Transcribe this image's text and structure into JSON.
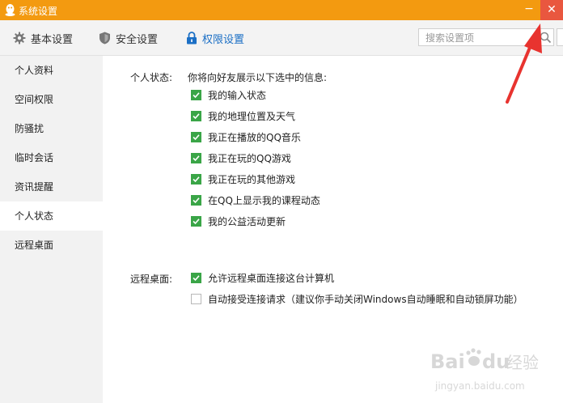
{
  "window": {
    "title": "系统设置",
    "minimize_glyph": "−",
    "close_glyph": "✕",
    "accent": "#f39a10",
    "close_bg": "#e9573f"
  },
  "toolbar": {
    "tabs": [
      {
        "label": "基本设置",
        "icon": "gear-icon",
        "active": false
      },
      {
        "label": "安全设置",
        "icon": "shield-icon",
        "active": false
      },
      {
        "label": "权限设置",
        "icon": "lock-icon",
        "active": true
      }
    ],
    "search_placeholder": "搜索设置项",
    "active_color": "#1b6fc5"
  },
  "sidebar": {
    "items": [
      {
        "label": "个人资料",
        "active": false
      },
      {
        "label": "空间权限",
        "active": false
      },
      {
        "label": "防骚扰",
        "active": false
      },
      {
        "label": "临时会话",
        "active": false
      },
      {
        "label": "资讯提醒",
        "active": false
      },
      {
        "label": "个人状态",
        "active": true
      },
      {
        "label": "远程桌面",
        "active": false
      }
    ]
  },
  "personal_status": {
    "label": "个人状态:",
    "intro": "你将向好友展示以下选中的信息:",
    "options": [
      {
        "label": "我的输入状态",
        "checked": true
      },
      {
        "label": "我的地理位置及天气",
        "checked": true
      },
      {
        "label": "我正在播放的QQ音乐",
        "checked": true
      },
      {
        "label": "我正在玩的QQ游戏",
        "checked": true
      },
      {
        "label": "我正在玩的其他游戏",
        "checked": true
      },
      {
        "label": "在QQ上显示我的课程动态",
        "checked": true
      },
      {
        "label": "我的公益活动更新",
        "checked": true
      }
    ]
  },
  "remote_desktop": {
    "label": "远程桌面:",
    "options": [
      {
        "label": "允许远程桌面连接这台计算机",
        "checked": true
      },
      {
        "label": "自动接受连接请求（建议你手动关闭Windows自动睡眠和自动锁屏功能）",
        "checked": false
      }
    ]
  },
  "watermark": {
    "brand": "Bai",
    "brand2": "du",
    "cn": "经验",
    "url": "jingyan.baidu.com"
  },
  "checkbox_color": "#3aa547",
  "annotation_color": "#e8332f"
}
